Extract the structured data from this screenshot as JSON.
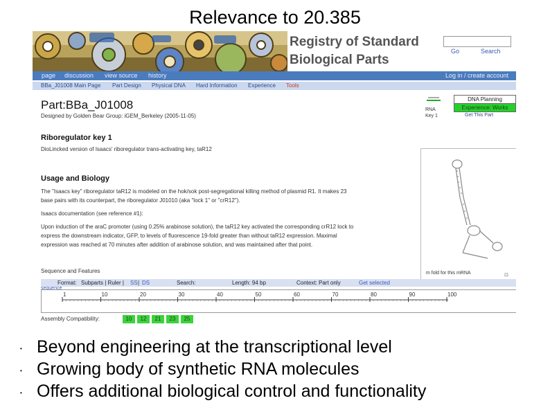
{
  "slide": {
    "title": "Relevance to 20.385",
    "bullets": [
      "Beyond engineering at the transcriptional level",
      "Growing body of synthetic RNA molecules",
      "Offers additional biological control and functionality"
    ]
  },
  "registry": {
    "site_title_line1": "Registry of Standard",
    "site_title_line2": "Biological Parts",
    "search": {
      "value": "",
      "go_label": "Go",
      "search_label": "Search"
    },
    "tabs": [
      "page",
      "discussion",
      "view source",
      "history"
    ],
    "login_label": "Log in / create account",
    "nav": [
      "BBa_J01008 Main Page",
      "Part Design",
      "Physical DNA",
      "Hard Information",
      "Experience",
      "Tools"
    ],
    "part_title": "Part:BBa_J01008",
    "designer_line": "Designed by Golden Bear   Group: iGEM_Berkeley   (2005-11-05)",
    "side": {
      "dna_planning": "DNA Planning",
      "experience_works": "Experience: Works",
      "get_part": "Get This Part",
      "rna_label": "RNA",
      "key_label": "Key 1"
    },
    "heading_main": "Riboregulator key 1",
    "subtitle": "DioLincked version of Isaacs' riboregulator trans-activating key, taR12",
    "heading_usage": "Usage and Biology",
    "para1_line1": "The \"Isaacs key\" riboregulator taR12 is modeled on the hok/sok post-segregational killing method of plasmid R1. It makes 23",
    "para1_line2": "base pairs with its counterpart, the riboregulator J01010 (aka \"lock 1\" or \"crR12\").",
    "para2": "Isaacs documentation (see reference #1):",
    "para3_line1": "Upon induction of the araC promoter (using 0.25% arabinose solution), the taR12 key activated the corresponding crR12 lock to",
    "para3_line2": "express the downstream indicator, GFP, to levels of fluorescence 19-fold greater than without taR12 expression. Maximal",
    "para3_line3": "expression was reached at 70 minutes after addition of arabinose solution, and was maintained after that point.",
    "fold_caption": "m fold for this mRNA",
    "expand_icon": "⊡",
    "seq_header": "Sequence and Features",
    "seqbar": {
      "format_label": "Format:",
      "format_options": "Subparts | Ruler |",
      "link_ss": "SS",
      "link_ds": "DS",
      "search_label": "Search:",
      "length": "Length: 94 bp",
      "context": "Context: Part only",
      "get_selected": "Get selected"
    },
    "seq_label": "sequence",
    "ruler_ticks": [
      "1",
      "10",
      "20",
      "30",
      "40",
      "50",
      "60",
      "70",
      "80",
      "90",
      "100"
    ],
    "assembly_label": "Assembly Compatibility:",
    "assembly_standards": [
      "10",
      "12",
      "21",
      "23",
      "25"
    ]
  },
  "colors": {
    "tab_bar": "#4a7bbd",
    "nav_bar": "#ccd8ee",
    "experience_green": "#25d128",
    "assembly_green": "#3dd23d",
    "link_blue": "#3c59b6"
  }
}
